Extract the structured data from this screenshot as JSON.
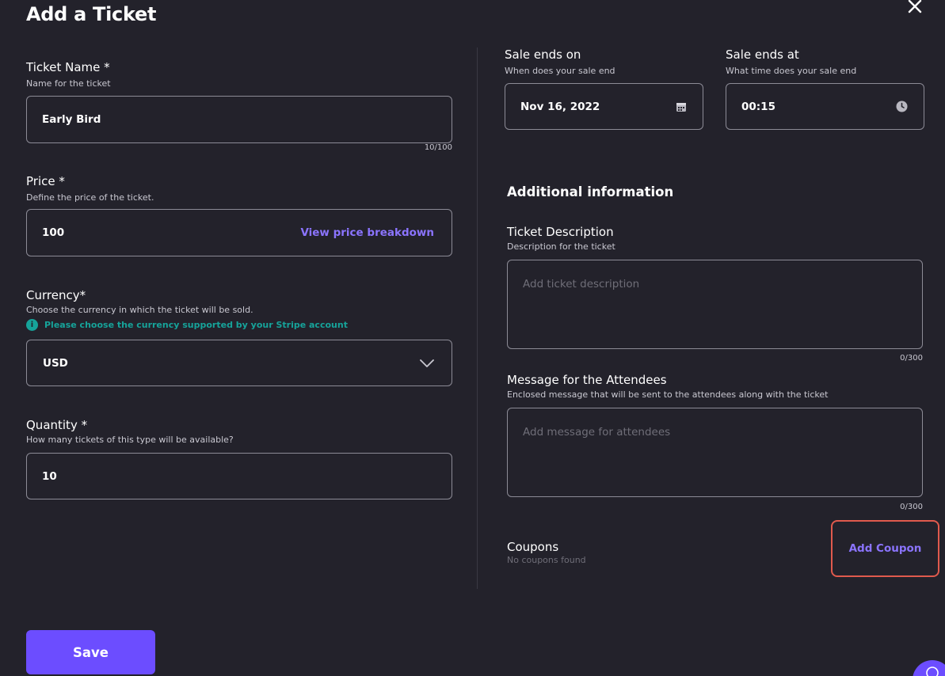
{
  "dialog": {
    "title": "Add a Ticket",
    "close_icon": "close-icon"
  },
  "ticket_name": {
    "label": "Ticket Name *",
    "help": "Name for the ticket",
    "value": "Early Bird",
    "counter": "10/100"
  },
  "price": {
    "label": "Price *",
    "help": "Define the price of the ticket.",
    "value": "100",
    "breakdown_link": "View price breakdown"
  },
  "currency": {
    "label": "Currency*",
    "help": "Choose the currency in which the ticket will be sold.",
    "note": "Please choose the currency supported by your Stripe account",
    "note_icon": "info-icon",
    "selected": "USD"
  },
  "quantity": {
    "label": "Quantity *",
    "help": "How many tickets of this type will be available?",
    "value": "10"
  },
  "sale_end_date": {
    "label": "Sale ends on",
    "help": "When does your sale end",
    "value": "Nov 16, 2022",
    "icon": "calendar-icon"
  },
  "sale_end_time": {
    "label": "Sale ends at",
    "help": "What time does your sale end",
    "value": "00:15",
    "icon": "clock-icon"
  },
  "additional": {
    "heading": "Additional information",
    "description": {
      "label": "Ticket Description",
      "help": "Description for the ticket",
      "placeholder": "Add ticket description",
      "counter": "0/300"
    },
    "message": {
      "label": "Message for the Attendees",
      "help": "Enclosed message that will be sent to the attendees along with the ticket",
      "placeholder": "Add message for attendees",
      "counter": "0/300"
    },
    "coupons": {
      "label": "Coupons",
      "help": "No coupons found",
      "add_label": "Add Coupon"
    }
  },
  "actions": {
    "save_label": "Save"
  },
  "colors": {
    "background": "#23222b",
    "accent": "#6c4dff",
    "link": "#8b74ff",
    "info": "#16a39a",
    "highlight_border": "#e05a4d"
  }
}
